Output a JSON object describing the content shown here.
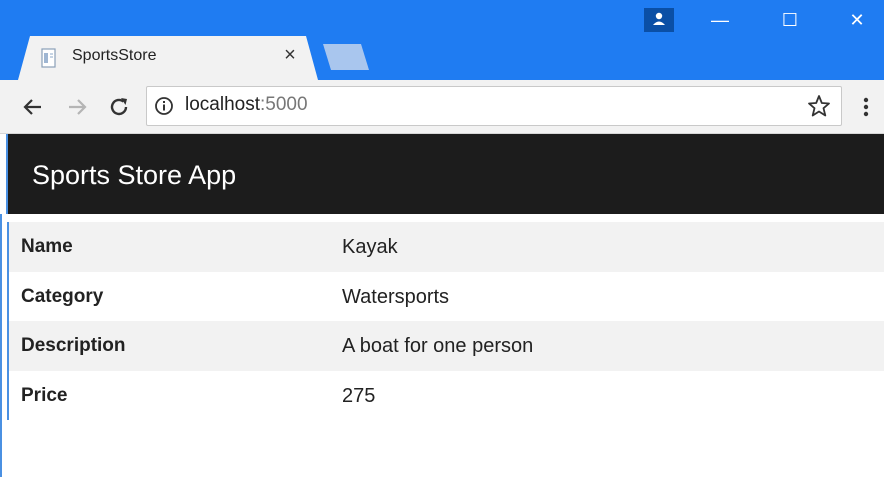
{
  "browser": {
    "tab_title": "SportsStore",
    "tab_close": "×",
    "url_host": "localhost",
    "url_port": ":5000",
    "window_controls": {
      "minimize": "—",
      "maximize": "☐",
      "close": "✕"
    },
    "icons": [
      "page-favicon-icon",
      "profile-icon",
      "back-arrow-icon",
      "forward-arrow-icon",
      "reload-icon",
      "info-icon",
      "bookmark-star-icon",
      "kebab-menu-icon"
    ]
  },
  "app": {
    "title": "Sports Store App"
  },
  "product": {
    "rows": [
      {
        "label": "Name",
        "value": "Kayak"
      },
      {
        "label": "Category",
        "value": "Watersports"
      },
      {
        "label": "Description",
        "value": "A boat for one person"
      },
      {
        "label": "Price",
        "value": "275"
      }
    ]
  },
  "colors": {
    "frame": "#1f7cf2",
    "header": "#1c1c1c",
    "stripe": "#f2f2f2"
  }
}
